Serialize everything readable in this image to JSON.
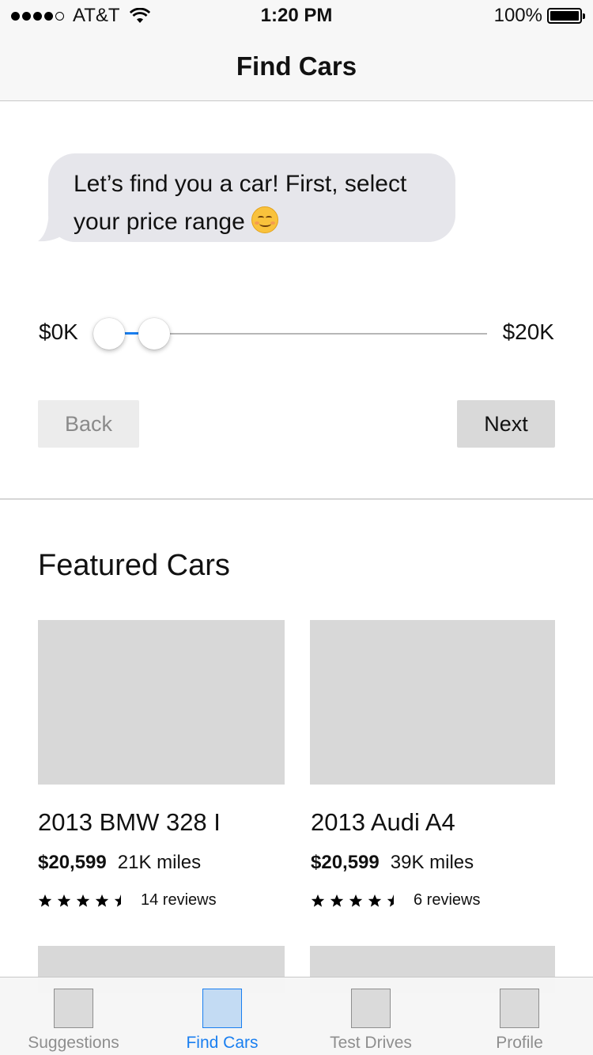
{
  "status_bar": {
    "carrier": "AT&T",
    "time": "1:20 PM",
    "battery": "100%",
    "battery_level": 1.0,
    "signal_bars_filled": 4,
    "signal_bars_total": 5
  },
  "nav": {
    "title": "Find Cars"
  },
  "chat": {
    "message": "Let’s find you a car! First, select your price range",
    "emoji_icon": "smiling-face-emoji-icon"
  },
  "price_slider": {
    "min_label": "$0K",
    "max_label": "$20K",
    "low_value": 0.0,
    "high_value": 0.12,
    "accent_color": "#1a7ff0"
  },
  "actions": {
    "back_label": "Back",
    "next_label": "Next"
  },
  "featured": {
    "title": "Featured Cars",
    "cars": [
      {
        "name": "2013 BMW 328 I",
        "price": "$20,599",
        "miles": "21K miles",
        "rating": 4.5,
        "reviews": "14 reviews"
      },
      {
        "name": "2013 Audi A4",
        "price": "$20,599",
        "miles": "39K miles",
        "rating": 4.5,
        "reviews": "6 reviews"
      }
    ]
  },
  "tabs": [
    {
      "label": "Suggestions",
      "active": false
    },
    {
      "label": "Find Cars",
      "active": true
    },
    {
      "label": "Test Drives",
      "active": false
    },
    {
      "label": "Profile",
      "active": false
    }
  ]
}
